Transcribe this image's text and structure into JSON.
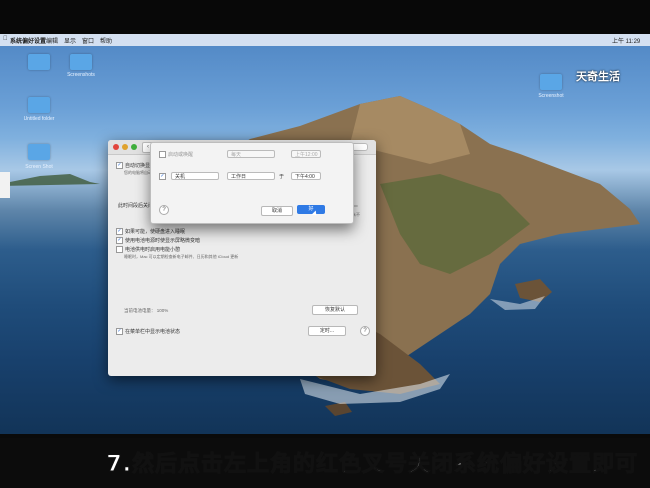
{
  "menubar": {
    "app": "系统偏好设置",
    "items": [
      "编辑",
      "显示",
      "窗口",
      "帮助"
    ],
    "clock": "上午 11:29"
  },
  "watermark": "天奇生活",
  "desktop": {
    "icons": [
      {
        "label": ""
      },
      {
        "label": "Screenshots"
      },
      {
        "label": "Untitled folder"
      },
      {
        "label": "Screen Shot"
      },
      {
        "label": ""
      },
      {
        "label": "Screenshot"
      }
    ]
  },
  "dialog": {
    "title": "节能",
    "auto_switch": "自动切换显卡",
    "auto_switch_desc": "您的电脑将自动在图形模式间切换",
    "turn_off_display": "此时间段后关闭显示器：",
    "slider_end": "永不",
    "opt1": "如果可能，使硬盘进入睡眠",
    "opt2": "使用电池电源时使显示屏略微变暗",
    "opt3": "电池供电时启用电能小憩",
    "opt3_desc": "睡眠时，Mac 可以定期检查新电子邮件、日历和其他 iCloud 更新",
    "battery_label": "当前电池电量：",
    "battery_value": "100%",
    "restore_defaults": "恢复默认",
    "show_status": "在菜单栏中显示电池状态",
    "schedule": "定时...",
    "help": "?"
  },
  "sheet": {
    "row1_check": "启动或唤醒",
    "row1_day": "每天",
    "row1_time": "上午12:00",
    "row2_action": "关机",
    "row2_day": "工作日",
    "row2_at": "于",
    "row2_time": "下午4:00",
    "cancel": "取消",
    "ok": "好",
    "help": "?"
  },
  "caption": "7.然后点击左上角的红色叉号关闭系统偏好设置即可",
  "colors": {
    "accent": "#2f7ae5",
    "close_dot": "#e2453c",
    "min_dot": "#e0a22c",
    "max_dot": "#3fae3c"
  }
}
